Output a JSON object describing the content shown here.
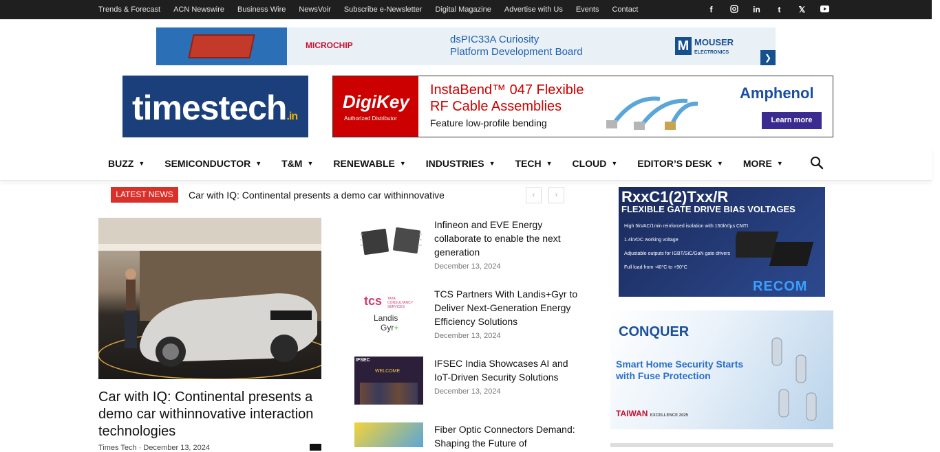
{
  "topbar": {
    "links": [
      "Trends & Forecast",
      "ACN Newswire",
      "Business Wire",
      "NewsVoir",
      "Subscribe e-Newsletter",
      "Digital Magazine",
      "Advertise with Us",
      "Events",
      "Contact"
    ],
    "social_icons": [
      "facebook-icon",
      "instagram-icon",
      "linkedin-icon",
      "tumblr-icon",
      "x-icon",
      "youtube-icon"
    ]
  },
  "ad_top": {
    "brand": "MICROCHIP",
    "headline_1": "dsPIC33A Curiosity",
    "headline_2": "Platform Development Board",
    "partner": "MOUSER",
    "partner_sub": "ELECTRONICS",
    "arrow": "❯"
  },
  "logo": {
    "text": "timestech",
    "suffix": ".in"
  },
  "ad_digikey": {
    "brand": "DigiKey",
    "brand_sub": "Authorized Distributor",
    "headline_1": "InstaBend™ 047 Flexible",
    "headline_2": "RF Cable Assemblies",
    "subhead": "Feature low-profile bending",
    "partner": "Amphenol",
    "cta": "Learn more"
  },
  "nav": {
    "items": [
      "BUZZ",
      "SEMICONDUCTOR",
      "T&M",
      "RENEWABLE",
      "INDUSTRIES",
      "TECH",
      "CLOUD",
      "EDITOR’S DESK",
      "MORE"
    ]
  },
  "ticker": {
    "label": "LATEST NEWS",
    "text": "Car with IQ: Continental presents a demo car withinnovative",
    "prev": "‹",
    "next": "›"
  },
  "featured": {
    "title": "Car with IQ: Continental presents a demo car withinnovative interaction technologies",
    "meta": "Times Tech · December 13, 2024"
  },
  "news": [
    {
      "title": "Infineon and EVE Energy collaborate to enable the next generation",
      "date": "December 13, 2024"
    },
    {
      "title": "TCS Partners With Landis+Gyr to Deliver Next-Generation Energy Efficiency Solutions",
      "date": "December 13, 2024"
    },
    {
      "title": "IFSEC India Showcases AI and IoT-Driven Security Solutions",
      "date": "December 13, 2024"
    },
    {
      "title": "Fiber Optic Connectors Demand: Shaping the Future of",
      "date": ""
    }
  ],
  "thumb_tcs": {
    "brand": "tcs",
    "sub": "TATA CONSULTANCY SERVICES",
    "partner_1": "Landis",
    "partner_2": "Gyr"
  },
  "thumb_ifsec": {
    "label": "IFSEC",
    "welcome": "WELCOME"
  },
  "ad_recom": {
    "title": "RxxC1(2)Txx/R",
    "subtitle": "FLEXIBLE GATE DRIVE BIAS VOLTAGES",
    "bullets": [
      "High 5kVAC/1min reinforced isolation with 150kV/µs CMTI",
      "1.4kVDC working voltage",
      "Adjustable outputs for IGBT/SiC/GaN gate drivers",
      "Full load from -40°C to +90°C"
    ],
    "brand": "RECOM"
  },
  "ad_conquer": {
    "brand": "CONQUER",
    "line_1": "Smart Home Security Starts",
    "line_2": "with Fuse Protection",
    "badge": "TAIWAN",
    "badge_sub": "EXCELLENCE 2025"
  },
  "colors": {
    "accent_red": "#d9302a",
    "topbar_bg": "#1f1f1f",
    "logo_bg": "#1a3f7a"
  }
}
